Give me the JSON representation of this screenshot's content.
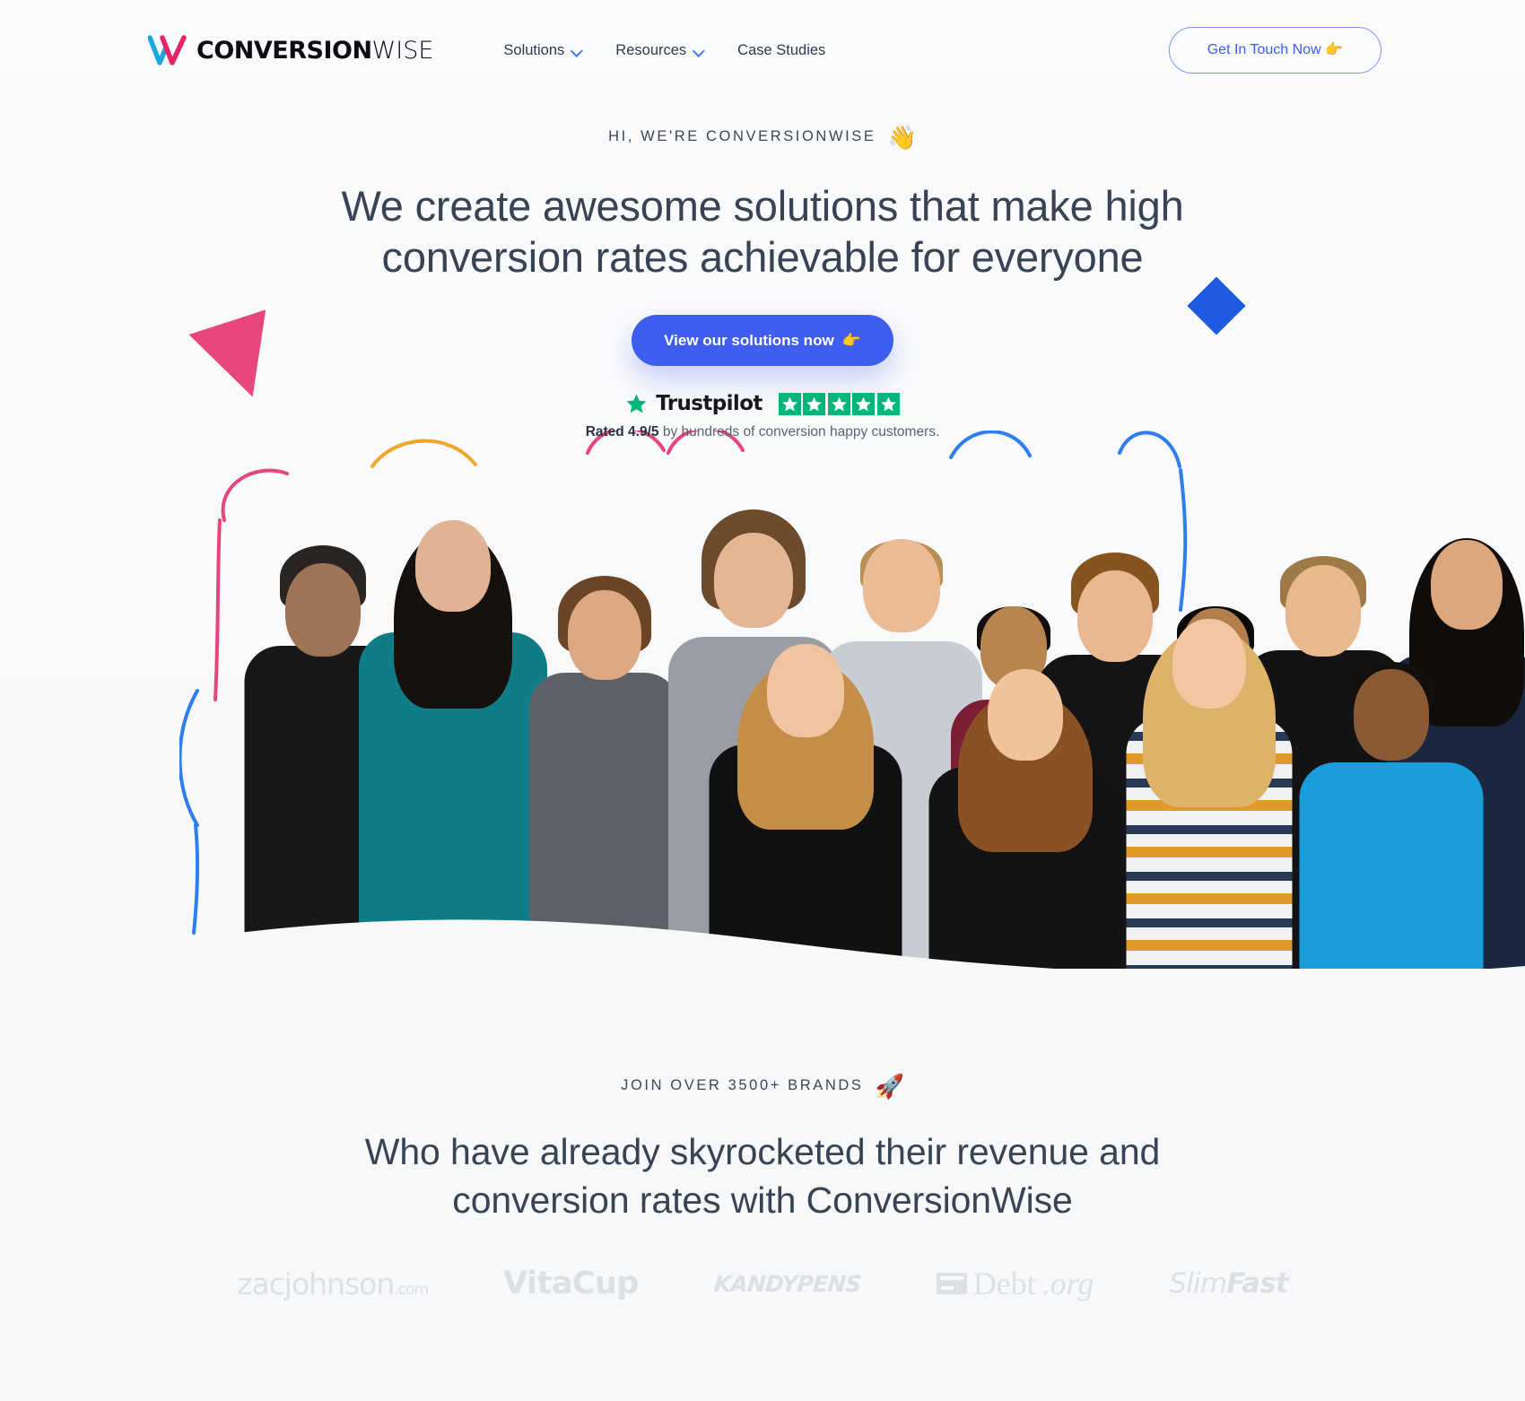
{
  "header": {
    "logo": {
      "bold_part": "CONVERSION",
      "light_part": "WISE",
      "mark_colors": {
        "blue": "#1ba7e0",
        "pink": "#e8236b"
      }
    },
    "nav": [
      {
        "label": "Solutions",
        "has_dropdown": true
      },
      {
        "label": "Resources",
        "has_dropdown": true
      },
      {
        "label": "Case Studies",
        "has_dropdown": false
      }
    ],
    "cta": {
      "label": "Get In Touch Now",
      "emoji": "👉"
    }
  },
  "hero": {
    "eyebrow": "HI, WE'RE CONVERSIONWISE",
    "eyebrow_emoji": "👋",
    "title_line1": "We create awesome solutions that make high",
    "title_line2": "conversion rates achievable for everyone",
    "cta": {
      "label": "View our solutions now",
      "emoji": "👉"
    },
    "trustpilot": {
      "name": "Trustpilot",
      "stars": 5,
      "star_color": "#00b67a",
      "rating_bold": "Rated 4.9/5",
      "rating_rest": " by hundreds of conversion happy customers."
    },
    "shapes": {
      "triangle_color": "#e8457f",
      "diamond_color": "#1f5ae0"
    }
  },
  "brands": {
    "eyebrow": "JOIN OVER 3500+ BRANDS",
    "eyebrow_emoji": "🚀",
    "title_line1": "Who have already skyrocketed their revenue and",
    "title_line2": "conversion rates with ConversionWise",
    "logos": [
      {
        "id": "zacjohnson",
        "name": "zacjohnson",
        "suffix": ".com"
      },
      {
        "id": "vitacup",
        "name": "VitaCup"
      },
      {
        "id": "kandypens",
        "name": "KANDYPENS"
      },
      {
        "id": "debtorg",
        "name": "Debt",
        "suffix": ".org"
      },
      {
        "id": "slimfast",
        "name_light": "Slim",
        "name_bold": "Fast"
      }
    ]
  },
  "colors": {
    "accent_blue": "#3f5ef0",
    "outline_blue": "#8095f2",
    "page_bg": "#f7f8fa",
    "text_dark": "#3a4354",
    "logo_grey": "#dcdfe4"
  }
}
